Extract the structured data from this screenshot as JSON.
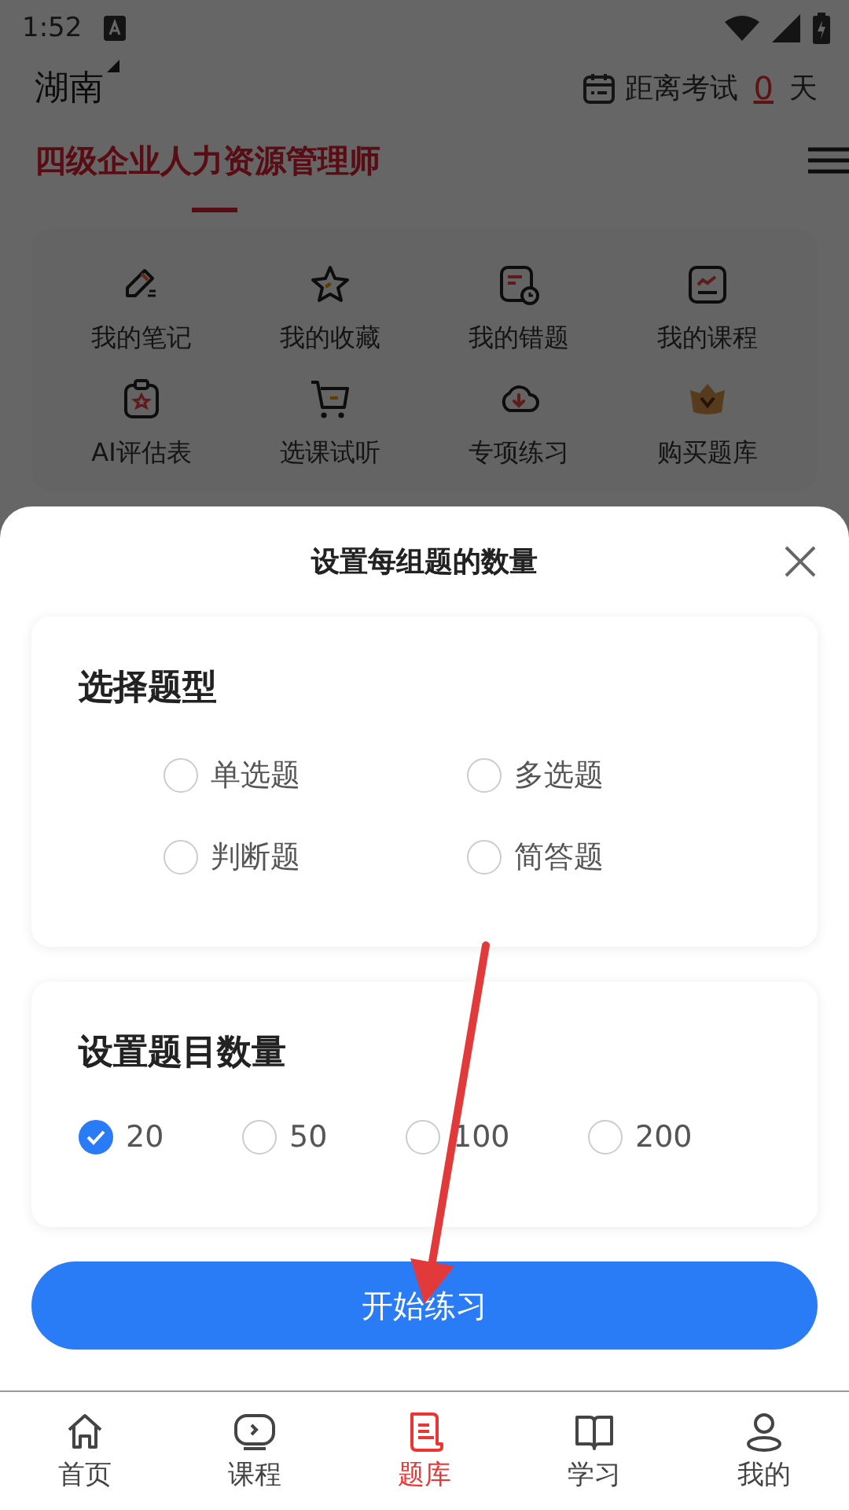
{
  "status_bar": {
    "time": "1:52"
  },
  "header": {
    "region": "湖南",
    "countdown_label": "距离考试",
    "countdown_days": "0",
    "countdown_unit": "天"
  },
  "course_title": "四级企业人力资源管理师",
  "shortcuts": [
    {
      "label": "我的笔记"
    },
    {
      "label": "我的收藏"
    },
    {
      "label": "我的错题"
    },
    {
      "label": "我的课程"
    },
    {
      "label": "AI评估表"
    },
    {
      "label": "选课试听"
    },
    {
      "label": "专项练习"
    },
    {
      "label": "购买题库"
    }
  ],
  "sheet": {
    "title": "设置每组题的数量",
    "sections": [
      {
        "kind": "type",
        "title": "选择题型",
        "options": [
          {
            "label": "单选题",
            "selected": false
          },
          {
            "label": "多选题",
            "selected": false
          },
          {
            "label": "判断题",
            "selected": false
          },
          {
            "label": "简答题",
            "selected": false
          }
        ]
      },
      {
        "kind": "count",
        "title": "设置题目数量",
        "options": [
          {
            "label": "20",
            "selected": true
          },
          {
            "label": "50",
            "selected": false
          },
          {
            "label": "100",
            "selected": false
          },
          {
            "label": "200",
            "selected": false
          }
        ]
      }
    ],
    "start_button": "开始练习"
  },
  "nav": [
    {
      "label": "首页",
      "selected": false
    },
    {
      "label": "课程",
      "selected": false
    },
    {
      "label": "题库",
      "selected": true
    },
    {
      "label": "学习",
      "selected": false
    },
    {
      "label": "我的",
      "selected": false
    }
  ]
}
